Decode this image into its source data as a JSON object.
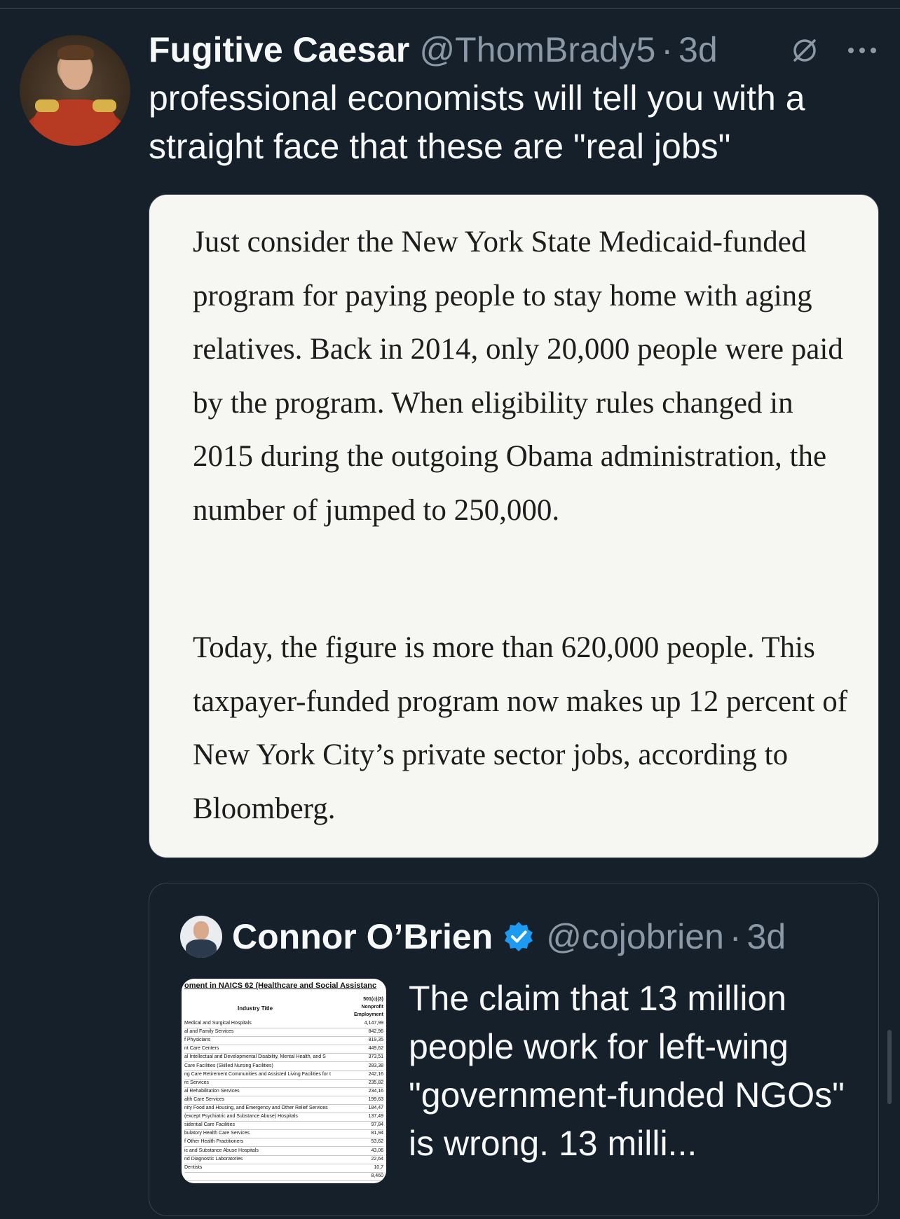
{
  "tweet": {
    "author_name": "Fugitive Caesar",
    "handle": "@ThomBrady5",
    "separator": "·",
    "time": "3d",
    "text": "professional economists will tell you with a straight face that these are \"real jobs\"",
    "icons": {
      "audience": "no-reply-icon",
      "menu": "more-icon"
    }
  },
  "media": {
    "paragraph1": "Just consider the New York State Medicaid-funded program for paying people to stay home with aging relatives. Back in 2014, only 20,000 people were paid by the program. When eligibility rules changed in 2015 during the outgoing Obama administration, the number of jumped to 250,000.",
    "paragraph2": "Today, the figure is more than 620,000 people. This taxpayer-funded program now makes up 12 percent of New York City’s private sector jobs, according to Bloomberg."
  },
  "quote": {
    "author_name": "Connor O’Brien",
    "handle": "@cojobrien",
    "separator": "·",
    "time": "3d",
    "text": "The claim that 13 million people work for left-wing \"government-funded NGOs\" is wrong. 13 milli...",
    "verified_color": "#1d9bf0",
    "thumbnail": {
      "title": "oment in NAICS 62 (Healthcare and Social Assistanc",
      "column_header": "Industry Title",
      "value_header": [
        "501(c)(3)",
        "Nonprofit",
        "Employment"
      ],
      "rows": [
        {
          "label": "Medical and Surgical Hospitals",
          "value": "4,147,99"
        },
        {
          "label": "al and Family Services",
          "value": "842,96"
        },
        {
          "label": "f Physicians",
          "value": "819,35"
        },
        {
          "label": "nt Care Centers",
          "value": "449,62"
        },
        {
          "label": "al Intellectual and Developmental Disability, Mental Health, and S",
          "value": "373,51"
        },
        {
          "label": "Care Facilities (Skilled Nursing Facilities)",
          "value": "283,38"
        },
        {
          "label": "ng Care Retirement Communities and Assisted Living Facilities for t",
          "value": "242,16"
        },
        {
          "label": "re Services",
          "value": "235,82"
        },
        {
          "label": "al Rehabilitation Services",
          "value": "234,16"
        },
        {
          "label": "alth Care Services",
          "value": "199,63"
        },
        {
          "label": "nity Food and Housing, and Emergency and Other Relief Services",
          "value": "184,47"
        },
        {
          "label": "(except Psychiatric and Substance Abuse) Hospitals",
          "value": "137,49"
        },
        {
          "label": "sidential Care Facilities",
          "value": "97,84"
        },
        {
          "label": "bulatory Health Care Services",
          "value": "81,94"
        },
        {
          "label": "f Other Health Practitioners",
          "value": "53,62"
        },
        {
          "label": "ic and Substance Abuse Hospitals",
          "value": "43,06"
        },
        {
          "label": "nd Diagnostic Laboratories",
          "value": "22,64"
        },
        {
          "label": "Dentists",
          "value": "10,7"
        },
        {
          "label": "",
          "value": "8,460"
        }
      ]
    }
  }
}
